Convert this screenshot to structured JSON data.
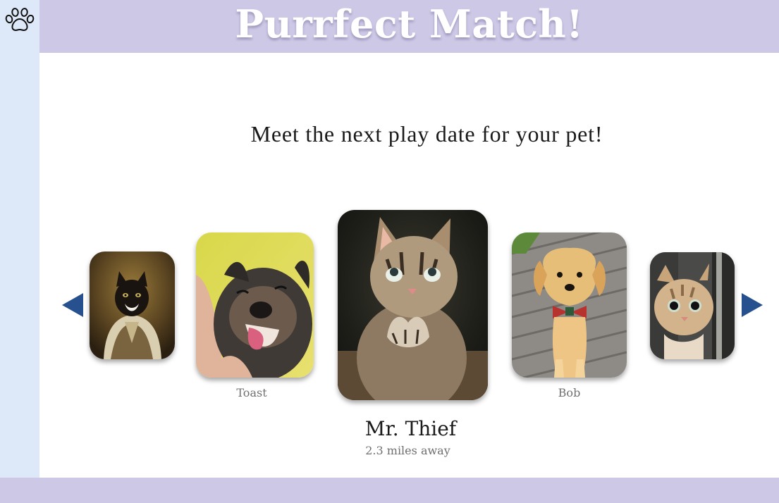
{
  "app": {
    "title": "Purrfect Match!",
    "menu_icon": "paw-icon"
  },
  "main": {
    "tagline": "Meet the next play date for your pet!"
  },
  "carousel": {
    "prev_icon": "triangle-left-icon",
    "next_icon": "triangle-right-icon",
    "pets": [
      {
        "name": "",
        "photo": "cat in royal portrait costume"
      },
      {
        "name": "Toast",
        "photo": "happy dog being petted"
      },
      {
        "name": "Mr. Thief",
        "photo": "tabby kitten with paws raised",
        "distance": "2.3 miles away",
        "featured": true
      },
      {
        "name": "Bob",
        "photo": "golden retriever puppy with plaid bow tie"
      },
      {
        "name": "",
        "photo": "kitten peeking around a door"
      }
    ]
  },
  "colors": {
    "header": "#cdc8e6",
    "sidebar": "#dde9f8",
    "arrow": "#27508f",
    "title_text": "#ffffff"
  }
}
